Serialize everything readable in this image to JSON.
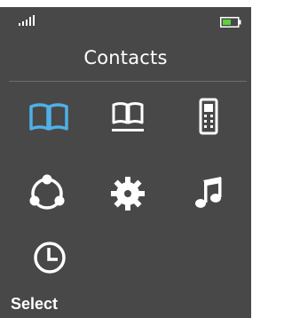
{
  "status": {
    "signal_icon": "signal-strength-icon",
    "battery_icon": "battery-icon",
    "battery_color": "#5bd13c"
  },
  "header": {
    "title": "Contacts"
  },
  "menu": {
    "selected_index": 0,
    "accent_color": "#4fb0e8",
    "items": [
      {
        "icon": "open-book-icon",
        "selected": true
      },
      {
        "icon": "address-book-icon",
        "selected": false
      },
      {
        "icon": "mobile-phone-icon",
        "selected": false
      },
      {
        "icon": "connectivity-icon",
        "selected": false
      },
      {
        "icon": "settings-gear-icon",
        "selected": false
      },
      {
        "icon": "music-note-icon",
        "selected": false
      },
      {
        "icon": "clock-icon",
        "selected": false
      }
    ]
  },
  "softkeys": {
    "left_label": "Select"
  }
}
